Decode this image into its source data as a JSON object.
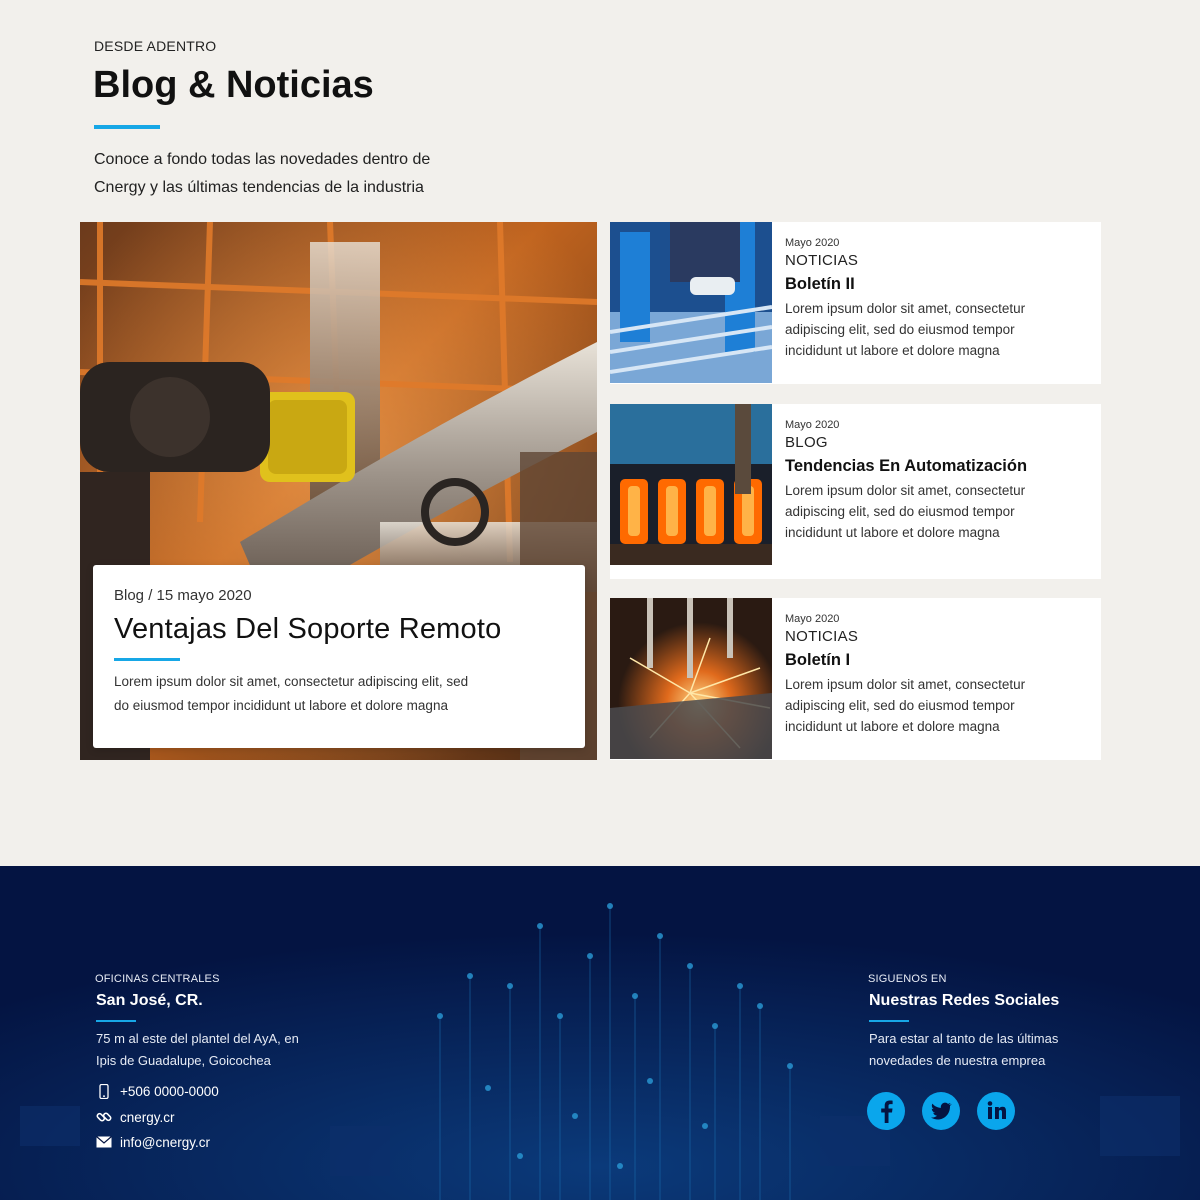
{
  "colors": {
    "accent": "#17a7e6",
    "footer_bg": "#041442",
    "page_bg": "#f2f0ec"
  },
  "section": {
    "eyebrow": "DESDE ADENTRO",
    "title": "Blog & Noticias",
    "intro_line1": "Conoce a fondo todas las novedades dentro de",
    "intro_line2": "Cnergy y las últimas tendencias de la industria"
  },
  "featured": {
    "meta": "Blog / 15 mayo 2020",
    "title": "Ventajas Del Soporte Remoto",
    "text_line1": "Lorem ipsum dolor sit amet, consectetur adipiscing elit, sed",
    "text_line2": "do eiusmod tempor incididunt ut labore et dolore magna"
  },
  "cards": [
    {
      "date": "Mayo 2020",
      "category": "NOTICIAS",
      "title": "Boletín II",
      "line1": "Lorem ipsum dolor sit amet, consectetur",
      "line2": "adipiscing elit, sed do eiusmod tempor",
      "line3": "incididunt ut labore et dolore magna"
    },
    {
      "date": "Mayo 2020",
      "category": "BLOG",
      "title": "Tendencias En Automatización",
      "line1": "Lorem ipsum dolor sit amet, consectetur",
      "line2": "adipiscing elit, sed do eiusmod tempor",
      "line3": "incididunt ut labore et dolore magna"
    },
    {
      "date": "Mayo 2020",
      "category": "NOTICIAS",
      "title": "Boletín I",
      "line1": "Lorem ipsum dolor sit amet, consectetur",
      "line2": "adipiscing elit, sed do eiusmod tempor",
      "line3": "incididunt ut labore et dolore magna"
    }
  ],
  "footer": {
    "office": {
      "eyebrow": "OFICINAS CENTRALES",
      "title": "San José, CR.",
      "address_line1": "75 m al este del plantel del AyA, en",
      "address_line2": "Ipis de Guadalupe, Goicochea",
      "phone": "+506 0000-0000",
      "website": "cnergy.cr",
      "email": "info@cnergy.cr"
    },
    "social": {
      "eyebrow": "SIGUENOS EN",
      "title": "Nuestras Redes Sociales",
      "text_line1": "Para estar al tanto de las últimas",
      "text_line2": "novedades de nuestra emprea",
      "icons": [
        "facebook-icon",
        "twitter-icon",
        "linkedin-icon"
      ]
    }
  }
}
